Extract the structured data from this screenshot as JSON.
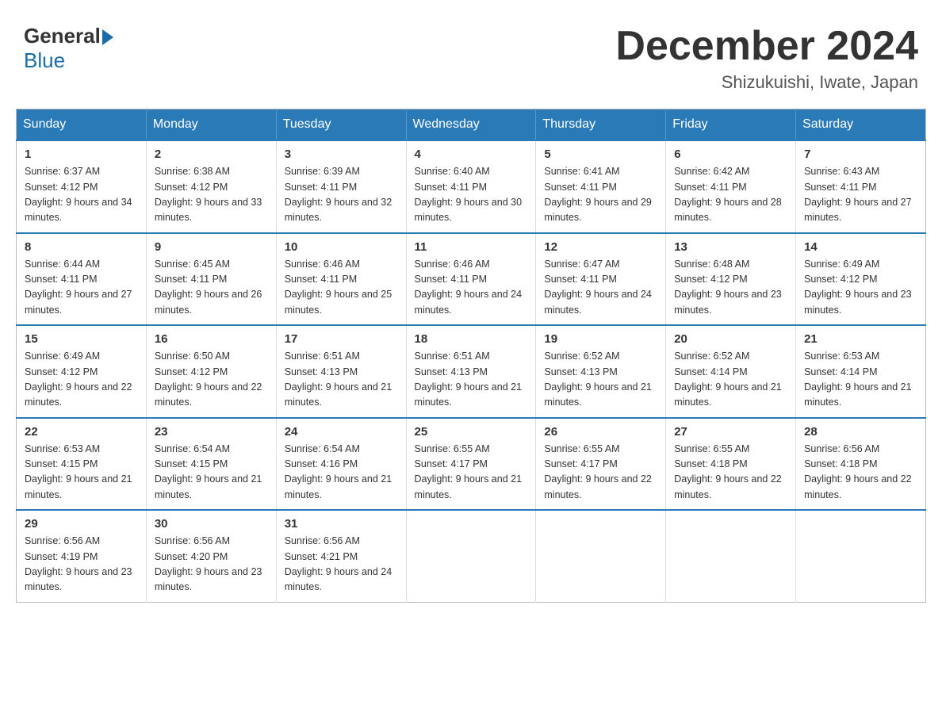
{
  "header": {
    "logo_general": "General",
    "logo_blue": "Blue",
    "title": "December 2024",
    "location": "Shizukuishi, Iwate, Japan"
  },
  "days_of_week": [
    "Sunday",
    "Monday",
    "Tuesday",
    "Wednesday",
    "Thursday",
    "Friday",
    "Saturday"
  ],
  "weeks": [
    [
      {
        "day": "1",
        "sunrise": "6:37 AM",
        "sunset": "4:12 PM",
        "daylight": "9 hours and 34 minutes."
      },
      {
        "day": "2",
        "sunrise": "6:38 AM",
        "sunset": "4:12 PM",
        "daylight": "9 hours and 33 minutes."
      },
      {
        "day": "3",
        "sunrise": "6:39 AM",
        "sunset": "4:11 PM",
        "daylight": "9 hours and 32 minutes."
      },
      {
        "day": "4",
        "sunrise": "6:40 AM",
        "sunset": "4:11 PM",
        "daylight": "9 hours and 30 minutes."
      },
      {
        "day": "5",
        "sunrise": "6:41 AM",
        "sunset": "4:11 PM",
        "daylight": "9 hours and 29 minutes."
      },
      {
        "day": "6",
        "sunrise": "6:42 AM",
        "sunset": "4:11 PM",
        "daylight": "9 hours and 28 minutes."
      },
      {
        "day": "7",
        "sunrise": "6:43 AM",
        "sunset": "4:11 PM",
        "daylight": "9 hours and 27 minutes."
      }
    ],
    [
      {
        "day": "8",
        "sunrise": "6:44 AM",
        "sunset": "4:11 PM",
        "daylight": "9 hours and 27 minutes."
      },
      {
        "day": "9",
        "sunrise": "6:45 AM",
        "sunset": "4:11 PM",
        "daylight": "9 hours and 26 minutes."
      },
      {
        "day": "10",
        "sunrise": "6:46 AM",
        "sunset": "4:11 PM",
        "daylight": "9 hours and 25 minutes."
      },
      {
        "day": "11",
        "sunrise": "6:46 AM",
        "sunset": "4:11 PM",
        "daylight": "9 hours and 24 minutes."
      },
      {
        "day": "12",
        "sunrise": "6:47 AM",
        "sunset": "4:11 PM",
        "daylight": "9 hours and 24 minutes."
      },
      {
        "day": "13",
        "sunrise": "6:48 AM",
        "sunset": "4:12 PM",
        "daylight": "9 hours and 23 minutes."
      },
      {
        "day": "14",
        "sunrise": "6:49 AM",
        "sunset": "4:12 PM",
        "daylight": "9 hours and 23 minutes."
      }
    ],
    [
      {
        "day": "15",
        "sunrise": "6:49 AM",
        "sunset": "4:12 PM",
        "daylight": "9 hours and 22 minutes."
      },
      {
        "day": "16",
        "sunrise": "6:50 AM",
        "sunset": "4:12 PM",
        "daylight": "9 hours and 22 minutes."
      },
      {
        "day": "17",
        "sunrise": "6:51 AM",
        "sunset": "4:13 PM",
        "daylight": "9 hours and 21 minutes."
      },
      {
        "day": "18",
        "sunrise": "6:51 AM",
        "sunset": "4:13 PM",
        "daylight": "9 hours and 21 minutes."
      },
      {
        "day": "19",
        "sunrise": "6:52 AM",
        "sunset": "4:13 PM",
        "daylight": "9 hours and 21 minutes."
      },
      {
        "day": "20",
        "sunrise": "6:52 AM",
        "sunset": "4:14 PM",
        "daylight": "9 hours and 21 minutes."
      },
      {
        "day": "21",
        "sunrise": "6:53 AM",
        "sunset": "4:14 PM",
        "daylight": "9 hours and 21 minutes."
      }
    ],
    [
      {
        "day": "22",
        "sunrise": "6:53 AM",
        "sunset": "4:15 PM",
        "daylight": "9 hours and 21 minutes."
      },
      {
        "day": "23",
        "sunrise": "6:54 AM",
        "sunset": "4:15 PM",
        "daylight": "9 hours and 21 minutes."
      },
      {
        "day": "24",
        "sunrise": "6:54 AM",
        "sunset": "4:16 PM",
        "daylight": "9 hours and 21 minutes."
      },
      {
        "day": "25",
        "sunrise": "6:55 AM",
        "sunset": "4:17 PM",
        "daylight": "9 hours and 21 minutes."
      },
      {
        "day": "26",
        "sunrise": "6:55 AM",
        "sunset": "4:17 PM",
        "daylight": "9 hours and 22 minutes."
      },
      {
        "day": "27",
        "sunrise": "6:55 AM",
        "sunset": "4:18 PM",
        "daylight": "9 hours and 22 minutes."
      },
      {
        "day": "28",
        "sunrise": "6:56 AM",
        "sunset": "4:18 PM",
        "daylight": "9 hours and 22 minutes."
      }
    ],
    [
      {
        "day": "29",
        "sunrise": "6:56 AM",
        "sunset": "4:19 PM",
        "daylight": "9 hours and 23 minutes."
      },
      {
        "day": "30",
        "sunrise": "6:56 AM",
        "sunset": "4:20 PM",
        "daylight": "9 hours and 23 minutes."
      },
      {
        "day": "31",
        "sunrise": "6:56 AM",
        "sunset": "4:21 PM",
        "daylight": "9 hours and 24 minutes."
      },
      null,
      null,
      null,
      null
    ]
  ]
}
